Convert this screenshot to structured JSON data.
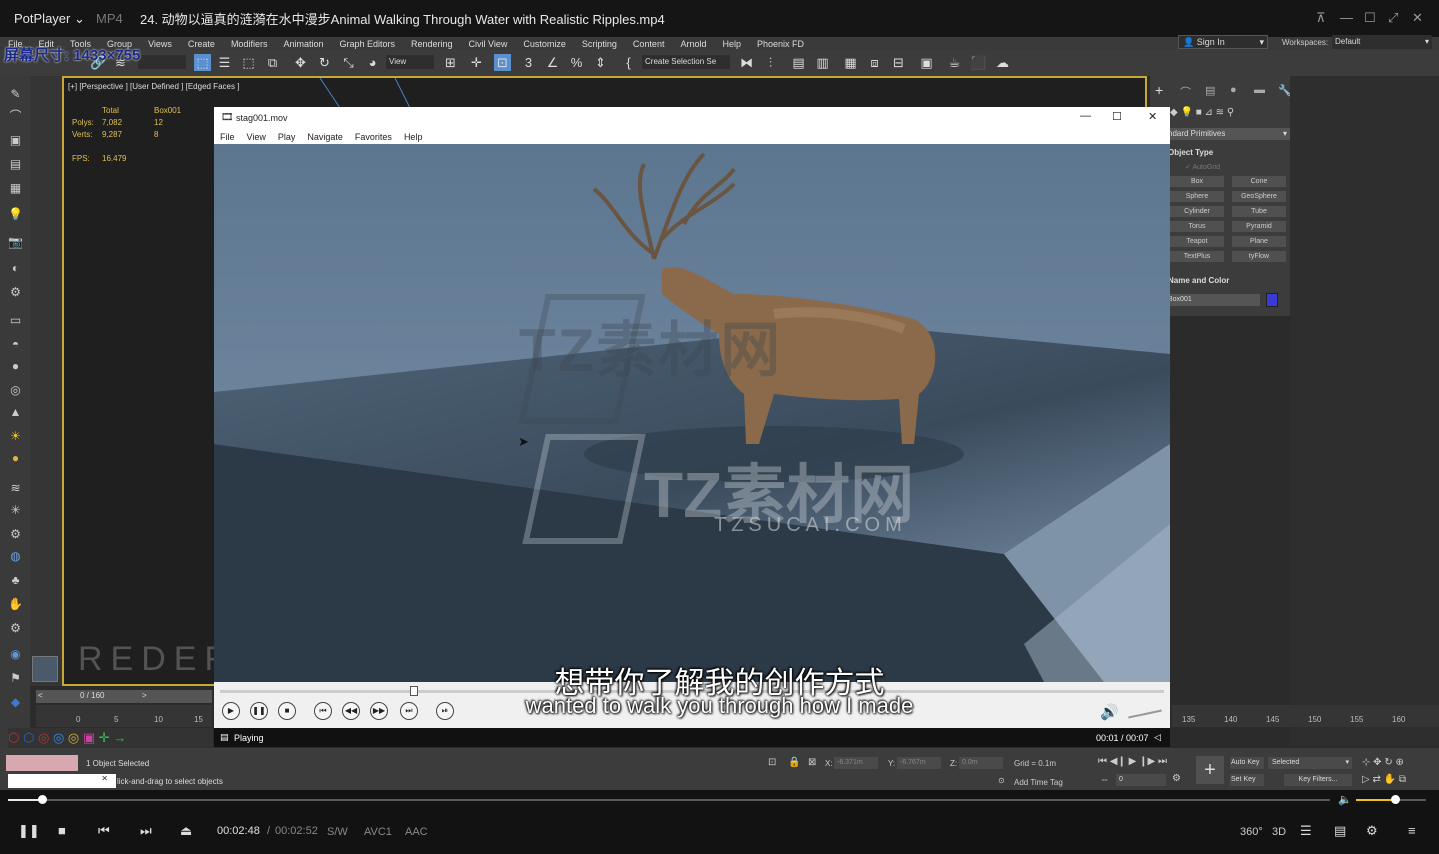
{
  "potplayer": {
    "app_name": "PotPlayer",
    "format": "MP4",
    "file_title": "24. 动物以逼真的涟漪在水中漫步Animal Walking Through Water with Realistic Ripples.mp4",
    "screen_size_label": "屏幕尺寸: 1433×755",
    "time_current": "00:02:48",
    "time_separator": "/",
    "time_total": "00:02:52",
    "renderer": "S/W",
    "video_codec": "AVC1",
    "audio_codec": "AAC",
    "seek_progress": 0.026,
    "volume_level": 0.55,
    "badges": [
      "360°",
      "3D"
    ]
  },
  "max": {
    "menu": [
      "File",
      "Edit",
      "Tools",
      "Group",
      "Views",
      "Create",
      "Modifiers",
      "Animation",
      "Graph Editors",
      "Rendering",
      "Civil View",
      "Customize",
      "Scripting",
      "Content",
      "Arnold",
      "Help",
      "Phoenix FD"
    ],
    "sign_in": "Sign In",
    "workspaces_label": "Workspaces:",
    "workspaces_value": "Default",
    "view_dropdown": "View",
    "create_selection": "Create Selection Se",
    "viewport_label": "[+] [Perspective ] [User Defined ] [Edged Faces ]",
    "stats": {
      "head_total": "Total",
      "head_obj": "Box001",
      "polys_label": "Polys:",
      "polys_total": "7,082",
      "polys_obj": "12",
      "verts_label": "Verts:",
      "verts_total": "9,287",
      "verts_obj": "8",
      "fps_label": "FPS:",
      "fps_value": "16.479"
    },
    "cmd": {
      "dropdown": "ndard Primitives",
      "object_type": "Object Type",
      "autogrid": "AutoGrid",
      "buttons": [
        "Box",
        "Cone",
        "Sphere",
        "GeoSphere",
        "Cylinder",
        "Tube",
        "Torus",
        "Pyramid",
        "Teapot",
        "Plane",
        "TextPlus",
        "tyFlow"
      ],
      "name_color": "Name and Color",
      "name_value": "Box001",
      "swatch": "#3a3ad8"
    },
    "timeline": {
      "frame_readout": "0 / 160",
      "ticks": [
        "0",
        "5",
        "10",
        "15"
      ],
      "ticks_right": [
        "135",
        "140",
        "145",
        "150",
        "155",
        "160"
      ]
    },
    "status": {
      "selected": "1 Object Selected",
      "hint": "lick-and-drag to select objects",
      "x_label": "X:",
      "x_value": "-6.371m",
      "y_label": "Y:",
      "y_value": "-6.767m",
      "z_label": "Z:",
      "z_value": "0.0m",
      "grid": "Grid = 0.1m",
      "add_time_tag": "Add Time Tag",
      "auto_key": "Auto Key",
      "selected_dd": "Selected",
      "set_key": "Set Key",
      "key_filters": "Key Filters...",
      "frame_field": "0"
    }
  },
  "media_window": {
    "title": "stag001.mov",
    "menu": [
      "File",
      "View",
      "Play",
      "Navigate",
      "Favorites",
      "Help"
    ],
    "status": "Playing",
    "time": "00:01 / 00:07"
  },
  "watermarks": {
    "brand_zh": "TZ素材网",
    "brand_en": "TZSUCAI.COM",
    "redefine": "REDEFINEFX.COM"
  },
  "subtitles": {
    "zh": "想带你了解我的创作方式",
    "en": "wanted to walk you through how I made"
  }
}
